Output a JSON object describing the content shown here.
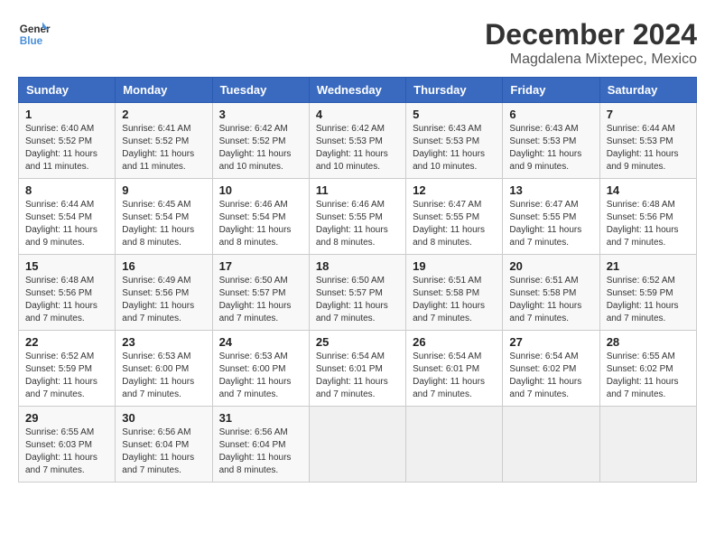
{
  "logo": {
    "line1": "General",
    "line2": "Blue"
  },
  "title": "December 2024",
  "subtitle": "Magdalena Mixtepec, Mexico",
  "days_of_week": [
    "Sunday",
    "Monday",
    "Tuesday",
    "Wednesday",
    "Thursday",
    "Friday",
    "Saturday"
  ],
  "weeks": [
    [
      {
        "day": 1,
        "sunrise": "6:40 AM",
        "sunset": "5:52 PM",
        "daylight": "11 hours and 11 minutes."
      },
      {
        "day": 2,
        "sunrise": "6:41 AM",
        "sunset": "5:52 PM",
        "daylight": "11 hours and 11 minutes."
      },
      {
        "day": 3,
        "sunrise": "6:42 AM",
        "sunset": "5:52 PM",
        "daylight": "11 hours and 10 minutes."
      },
      {
        "day": 4,
        "sunrise": "6:42 AM",
        "sunset": "5:53 PM",
        "daylight": "11 hours and 10 minutes."
      },
      {
        "day": 5,
        "sunrise": "6:43 AM",
        "sunset": "5:53 PM",
        "daylight": "11 hours and 10 minutes."
      },
      {
        "day": 6,
        "sunrise": "6:43 AM",
        "sunset": "5:53 PM",
        "daylight": "11 hours and 9 minutes."
      },
      {
        "day": 7,
        "sunrise": "6:44 AM",
        "sunset": "5:53 PM",
        "daylight": "11 hours and 9 minutes."
      }
    ],
    [
      {
        "day": 8,
        "sunrise": "6:44 AM",
        "sunset": "5:54 PM",
        "daylight": "11 hours and 9 minutes."
      },
      {
        "day": 9,
        "sunrise": "6:45 AM",
        "sunset": "5:54 PM",
        "daylight": "11 hours and 8 minutes."
      },
      {
        "day": 10,
        "sunrise": "6:46 AM",
        "sunset": "5:54 PM",
        "daylight": "11 hours and 8 minutes."
      },
      {
        "day": 11,
        "sunrise": "6:46 AM",
        "sunset": "5:55 PM",
        "daylight": "11 hours and 8 minutes."
      },
      {
        "day": 12,
        "sunrise": "6:47 AM",
        "sunset": "5:55 PM",
        "daylight": "11 hours and 8 minutes."
      },
      {
        "day": 13,
        "sunrise": "6:47 AM",
        "sunset": "5:55 PM",
        "daylight": "11 hours and 7 minutes."
      },
      {
        "day": 14,
        "sunrise": "6:48 AM",
        "sunset": "5:56 PM",
        "daylight": "11 hours and 7 minutes."
      }
    ],
    [
      {
        "day": 15,
        "sunrise": "6:48 AM",
        "sunset": "5:56 PM",
        "daylight": "11 hours and 7 minutes."
      },
      {
        "day": 16,
        "sunrise": "6:49 AM",
        "sunset": "5:56 PM",
        "daylight": "11 hours and 7 minutes."
      },
      {
        "day": 17,
        "sunrise": "6:50 AM",
        "sunset": "5:57 PM",
        "daylight": "11 hours and 7 minutes."
      },
      {
        "day": 18,
        "sunrise": "6:50 AM",
        "sunset": "5:57 PM",
        "daylight": "11 hours and 7 minutes."
      },
      {
        "day": 19,
        "sunrise": "6:51 AM",
        "sunset": "5:58 PM",
        "daylight": "11 hours and 7 minutes."
      },
      {
        "day": 20,
        "sunrise": "6:51 AM",
        "sunset": "5:58 PM",
        "daylight": "11 hours and 7 minutes."
      },
      {
        "day": 21,
        "sunrise": "6:52 AM",
        "sunset": "5:59 PM",
        "daylight": "11 hours and 7 minutes."
      }
    ],
    [
      {
        "day": 22,
        "sunrise": "6:52 AM",
        "sunset": "5:59 PM",
        "daylight": "11 hours and 7 minutes."
      },
      {
        "day": 23,
        "sunrise": "6:53 AM",
        "sunset": "6:00 PM",
        "daylight": "11 hours and 7 minutes."
      },
      {
        "day": 24,
        "sunrise": "6:53 AM",
        "sunset": "6:00 PM",
        "daylight": "11 hours and 7 minutes."
      },
      {
        "day": 25,
        "sunrise": "6:54 AM",
        "sunset": "6:01 PM",
        "daylight": "11 hours and 7 minutes."
      },
      {
        "day": 26,
        "sunrise": "6:54 AM",
        "sunset": "6:01 PM",
        "daylight": "11 hours and 7 minutes."
      },
      {
        "day": 27,
        "sunrise": "6:54 AM",
        "sunset": "6:02 PM",
        "daylight": "11 hours and 7 minutes."
      },
      {
        "day": 28,
        "sunrise": "6:55 AM",
        "sunset": "6:02 PM",
        "daylight": "11 hours and 7 minutes."
      }
    ],
    [
      {
        "day": 29,
        "sunrise": "6:55 AM",
        "sunset": "6:03 PM",
        "daylight": "11 hours and 7 minutes."
      },
      {
        "day": 30,
        "sunrise": "6:56 AM",
        "sunset": "6:04 PM",
        "daylight": "11 hours and 7 minutes."
      },
      {
        "day": 31,
        "sunrise": "6:56 AM",
        "sunset": "6:04 PM",
        "daylight": "11 hours and 8 minutes."
      },
      null,
      null,
      null,
      null
    ]
  ]
}
